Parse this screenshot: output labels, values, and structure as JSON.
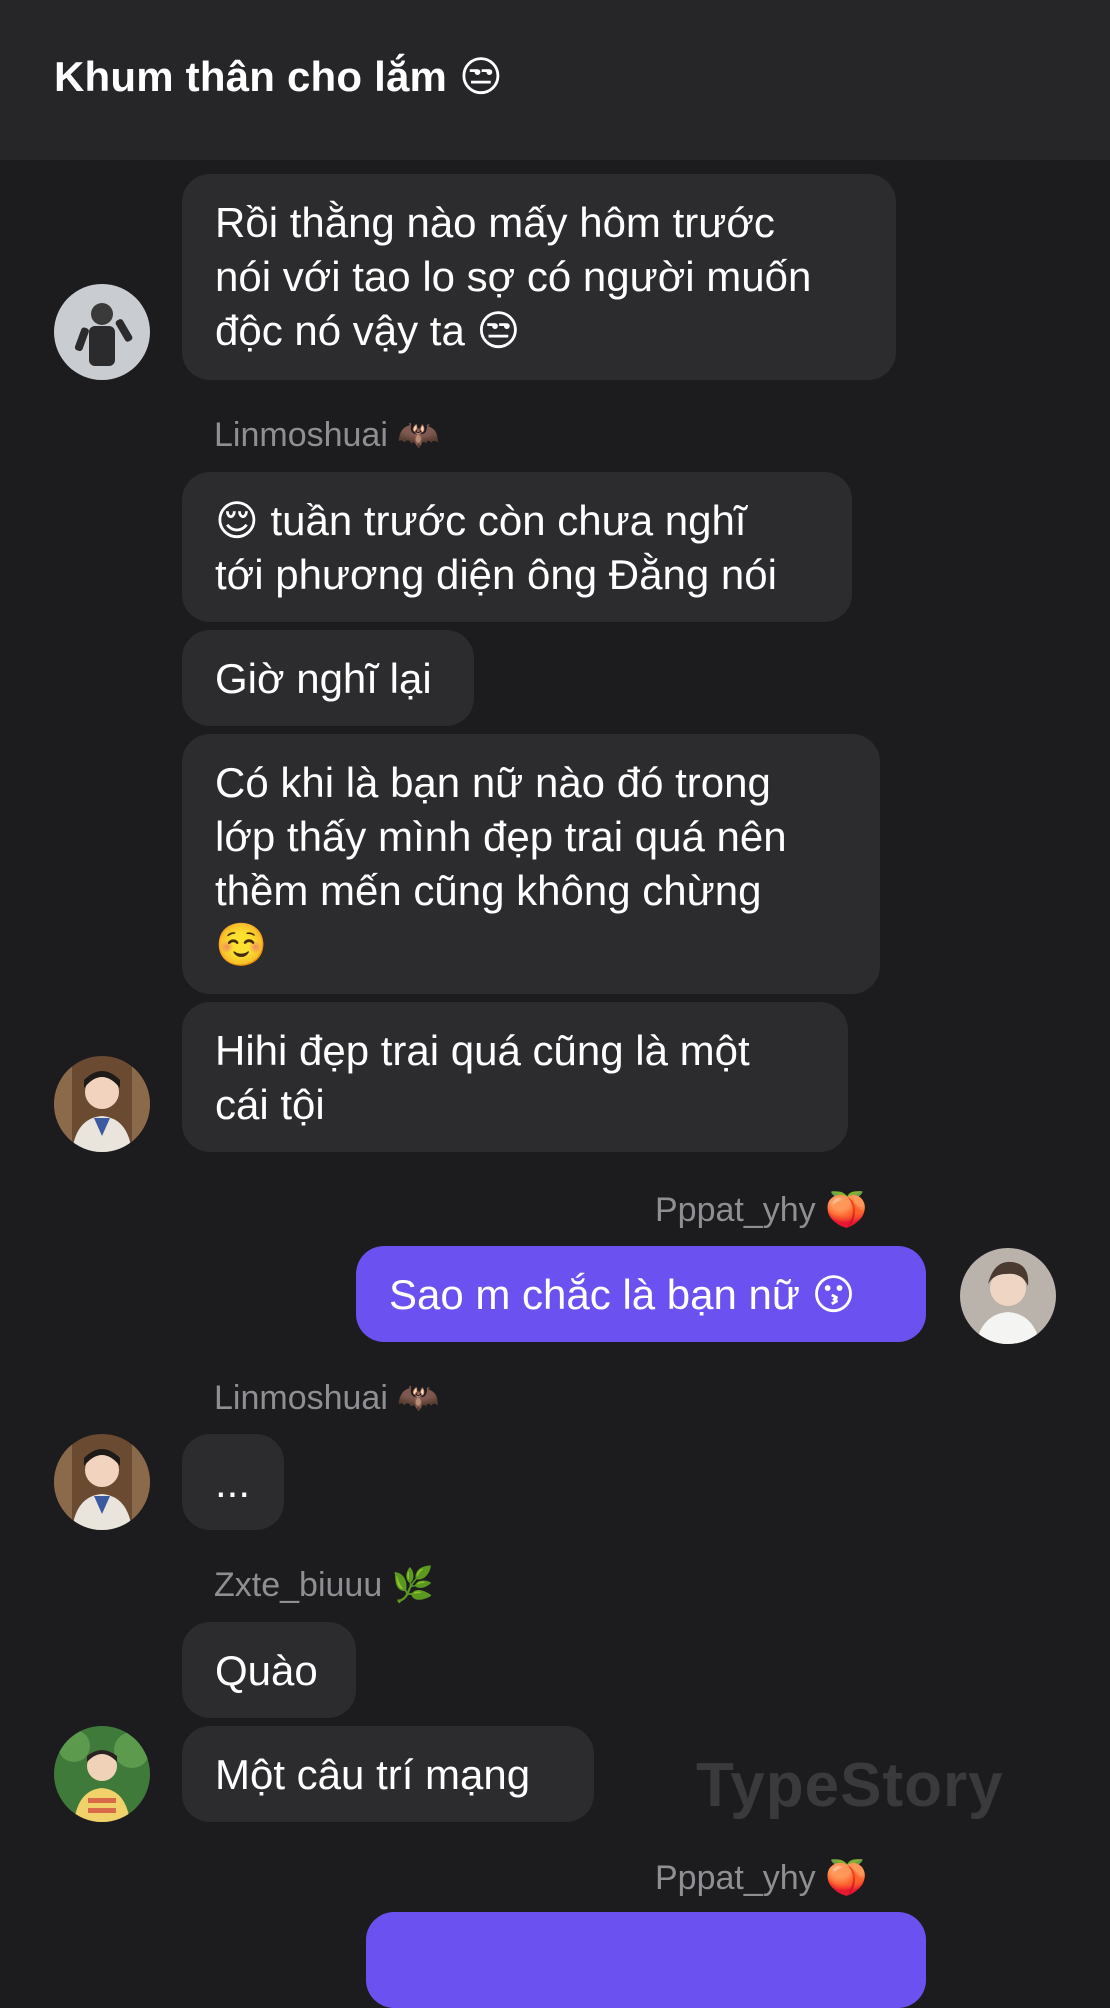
{
  "header": {
    "title": "Khum thân cho lắm 😒"
  },
  "messages": [
    {
      "text": "Rồi thằng nào mấy hôm trước\nnói với tao lo sợ có người muốn\nđộc nó vậy ta 😒"
    },
    {
      "sender": "Linmoshuai 🦇"
    },
    {
      "text": "😌 tuần trước còn chưa nghĩ\ntới phương diện ông Đằng nói"
    },
    {
      "text": "Giờ nghĩ lại"
    },
    {
      "text": "Có khi là bạn nữ nào đó trong\nlớp thấy mình đẹp trai quá nên\nthềm mến cũng không chừng\n☺️"
    },
    {
      "text": "Hihi đẹp trai quá cũng là một\ncái tội"
    },
    {
      "sender": "Pppat_yhy 🍑"
    },
    {
      "text": "Sao m chắc là bạn nữ 😗"
    },
    {
      "sender": "Linmoshuai 🦇"
    },
    {
      "text": "..."
    },
    {
      "sender": "Zxte_biuuu 🌿"
    },
    {
      "text": "Quào"
    },
    {
      "text": "Một câu trí mạng"
    },
    {
      "sender": "Pppat_yhy 🍑"
    }
  ],
  "watermark": "TypeStory",
  "colors": {
    "background": "#1c1c1e",
    "header": "#262628",
    "incoming_bubble": "#2c2c2f",
    "outgoing_bubble": "#6b52f0",
    "sender_text": "#8e8e93"
  }
}
